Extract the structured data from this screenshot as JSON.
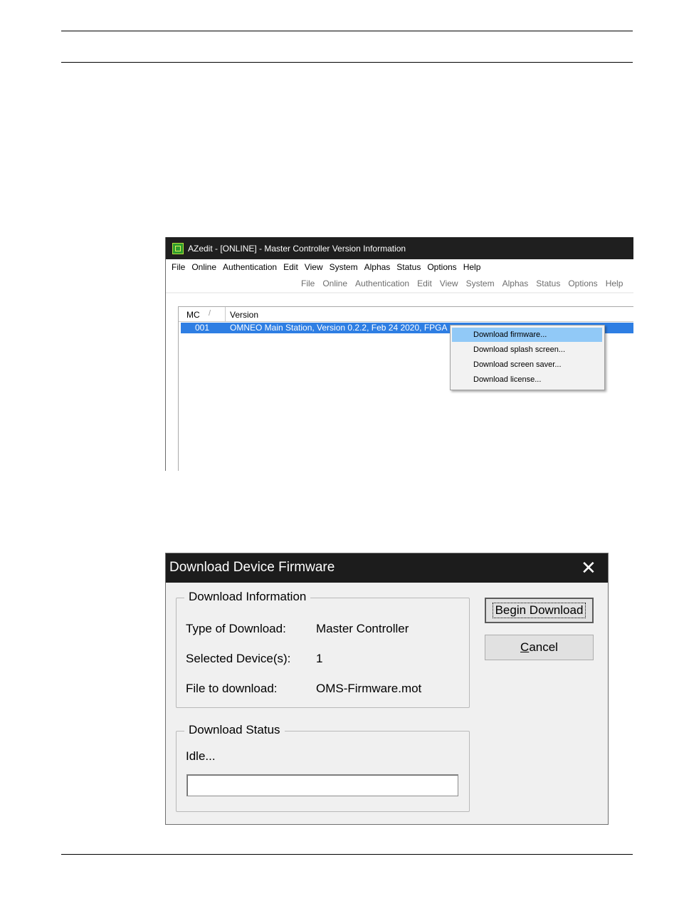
{
  "azedit": {
    "title": "AZedit - [ONLINE] - Master Controller Version Information",
    "menu": [
      "File",
      "Online",
      "Authentication",
      "Edit",
      "View",
      "System",
      "Alphas",
      "Status",
      "Options",
      "Help"
    ],
    "child_menu": [
      "File",
      "Online",
      "Authentication",
      "Edit",
      "View",
      "System",
      "Alphas",
      "Status",
      "Options",
      "Help"
    ],
    "columns": {
      "mc": "MC",
      "sort_indicator": "/",
      "version": "Version"
    },
    "rows": [
      {
        "mc": "001",
        "version": "OMNEO Main Station, Version 0.2.2, Feb 24 2020, FPGA"
      }
    ],
    "context_menu": [
      {
        "label": "Download firmware...",
        "highlighted": true
      },
      {
        "label": "Download splash screen...",
        "highlighted": false
      },
      {
        "label": "Download screen saver...",
        "highlighted": false
      },
      {
        "label": "Download license...",
        "highlighted": false
      }
    ],
    "colors": {
      "titlebar": "#1f1f1f",
      "selection": "#2e7ee3",
      "menu_highlight": "#91c9f7"
    }
  },
  "dialog": {
    "title": "Download Device Firmware",
    "close_glyph": "✕",
    "info_group": {
      "legend": "Download Information",
      "type_label": "Type of Download:",
      "type_value": "Master Controller",
      "devices_label": "Selected Device(s):",
      "devices_value": "1",
      "file_label": "File to download:",
      "file_value": "OMS-Firmware.mot"
    },
    "status_group": {
      "legend": "Download Status",
      "status_text": "Idle...",
      "progress": 0
    },
    "buttons": {
      "begin_label": "Begin Download",
      "cancel_label": "Cancel"
    }
  }
}
